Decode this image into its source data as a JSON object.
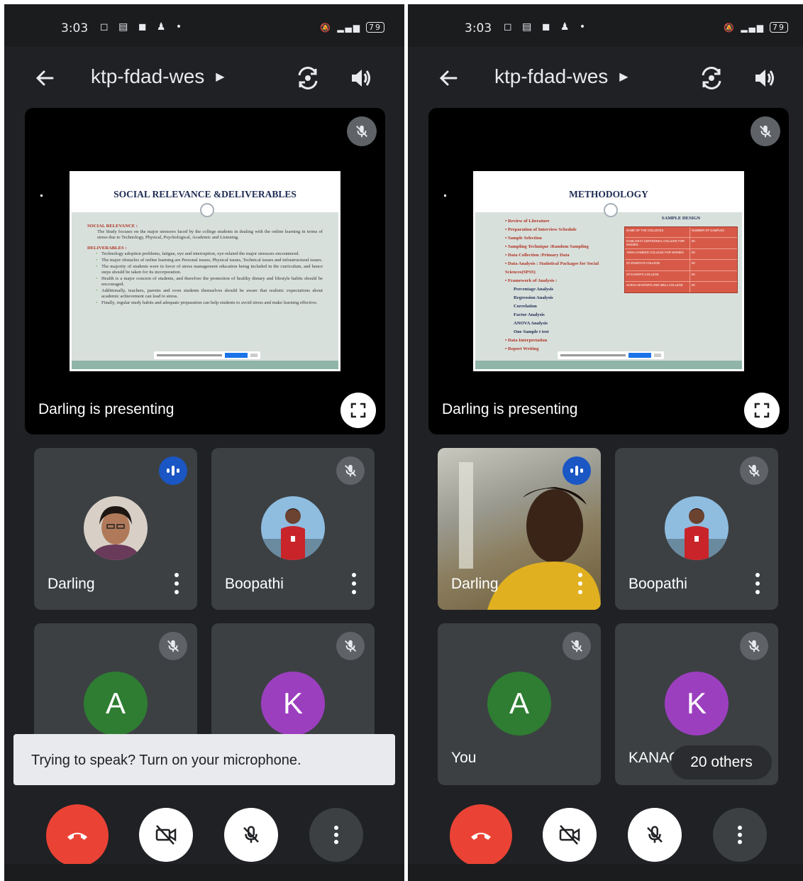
{
  "colors": {
    "background": "#202124",
    "tile": "#3c4043",
    "hangup": "#ea4335",
    "speaking": "#1a56c4",
    "avatar_a": "#2e7d32",
    "avatar_k": "#9c3fbf"
  },
  "status_bar": {
    "time": "3:03",
    "battery": "79"
  },
  "meeting": {
    "code": "ktp-fdad-wes",
    "presenting_label": "Darling is presenting"
  },
  "left_screen": {
    "slide": {
      "title": "SOCIAL RELEVANCE &DELIVERABLES",
      "section1": "SOCIAL RELEVANCE :",
      "para1": "The Study focuses on the major stressors faced by the college students in dealing with the online learning in terms of stress due to Technology, Physical, Psychological, Academic and Listening.",
      "section2": "DELIVERABLES :",
      "bullets": [
        "Technology adoption problems, fatigue, eye and interruption, eye-related the major stressors encountered.",
        "The major obstacles of online learning are Personal issues, Physical issues, Technical issues and infrastructural issues.",
        "The majority of students were in favor of stress management education being included in the curriculum, and hence steps should be taken for its incorporation.",
        "Health is a major concern of students, and therefore the promotion of healthy dietary and lifestyle habits should be encouraged.",
        "Additionally, teachers, parents and even students themselves should be aware that realistic expectations about academic achievement can lead to stress.",
        "Finally, regular study habits and adequate preparation can help students to avoid stress and make learning effective."
      ]
    },
    "tiles": [
      {
        "name": "Darling",
        "state": "speaking"
      },
      {
        "name": "Boopathi",
        "state": "muted"
      },
      {
        "letter": "A",
        "state": "muted"
      },
      {
        "letter": "K",
        "state": "muted"
      }
    ],
    "toast": "Trying to speak? Turn on your microphone."
  },
  "right_screen": {
    "slide": {
      "title": "METHODOLOGY",
      "items": [
        {
          "text": "Review of Literature",
          "style": "r"
        },
        {
          "text": "Preparation of Interview Schedule",
          "style": "r"
        },
        {
          "text": "Sample Selection",
          "style": "r"
        },
        {
          "text": "Sampling Technique :Random Sampling",
          "style": "r"
        },
        {
          "text": "Data Collection :Primary Data",
          "style": "r"
        },
        {
          "text": "Data Analysis : Statistical Packages for Social Sciences(SPSS)",
          "style": "r"
        },
        {
          "text": "Framework of Analysis :",
          "style": "r"
        },
        {
          "text": "Percentage Analysis",
          "style": "b"
        },
        {
          "text": "Regression Analysis",
          "style": "b"
        },
        {
          "text": "Correlation",
          "style": "b"
        },
        {
          "text": "Factor Analysis",
          "style": "b"
        },
        {
          "text": "ANOVA Analysis",
          "style": "b"
        },
        {
          "text": "One Sample t test",
          "style": "b"
        },
        {
          "text": "Data Interpretation",
          "style": "r"
        },
        {
          "text": "Report Writing",
          "style": "r"
        }
      ],
      "table_title": "SAMPLE DESIGN",
      "table_header": [
        "NAME OF THE COLLEGES",
        "NUMBER OF SAMPLES"
      ],
      "table_rows": [
        [
          "KAMLANIYA CENTENNIAL COLLEGE FOR WOMEN",
          "50"
        ],
        [
          "ANNAI HAMEED COLLEGE FOR WOMEN",
          "50"
        ],
        [
          "ST.JOSEPH'S COLLEGE",
          "50"
        ],
        [
          "ST.XAVIER'S COLLEGE",
          "50"
        ],
        [
          "SARAH MASTER'S AND WELL COLLEGE",
          "50"
        ]
      ]
    },
    "tiles": [
      {
        "name": "Darling",
        "state": "speaking"
      },
      {
        "name": "Boopathi",
        "state": "muted"
      },
      {
        "name": "You",
        "letter": "A",
        "state": "muted"
      },
      {
        "name": "KANAG",
        "letter": "K",
        "state": "muted"
      }
    ],
    "others": "20 others"
  }
}
